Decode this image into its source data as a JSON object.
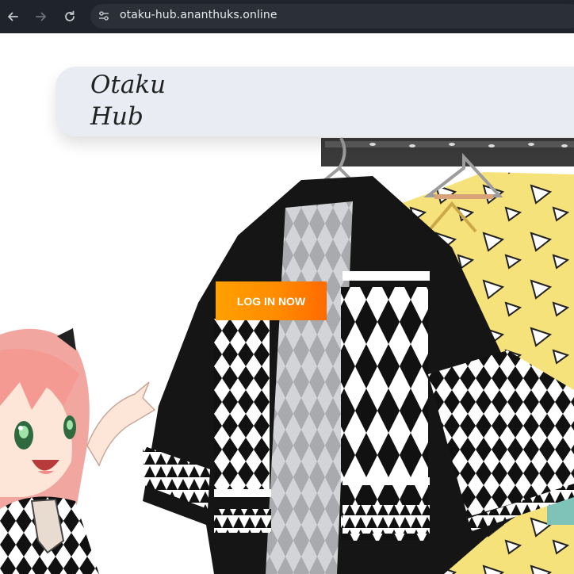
{
  "browser": {
    "url": "otaku-hub.ananthuks.online",
    "icons": [
      "back-arrow-icon",
      "forward-arrow-icon",
      "reload-icon",
      "site-settings-icon"
    ]
  },
  "header": {
    "logo_line1": "Otaku",
    "logo_line2": "Hub"
  },
  "hero": {
    "login_label": "LOG IN NOW"
  },
  "colors": {
    "chrome_bg": "#1f232b",
    "omnibox_bg": "#2a2f38",
    "header_bg": "#e9ecf2",
    "button_gradient_start": "#ffa000",
    "button_gradient_end": "#ff6a00"
  }
}
